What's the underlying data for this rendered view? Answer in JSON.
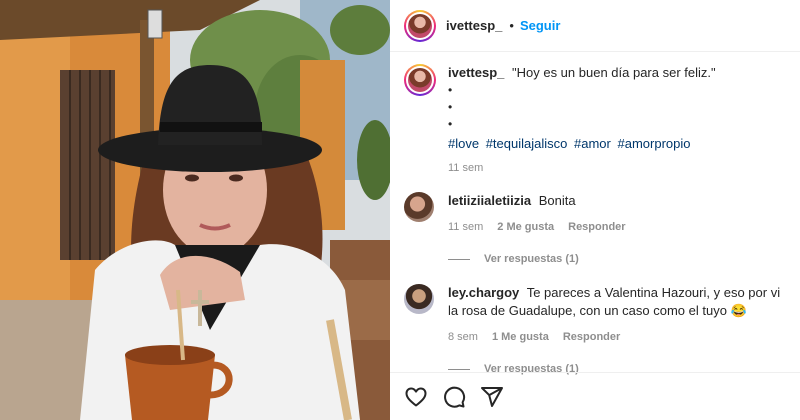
{
  "header": {
    "username": "ivettesp_",
    "separator": "•",
    "follow_label": "Seguir"
  },
  "caption": {
    "username": "ivettesp_",
    "text": "\"Hoy es un buen día para ser feliz.\"",
    "bullets": [
      "•",
      "•",
      "•"
    ],
    "hashtags": [
      "#love",
      "#tequilajalisco",
      "#amor",
      "#amorpropio"
    ],
    "time": "11 sem"
  },
  "comments": [
    {
      "username": "letiiziialetiizia",
      "text": "Bonita",
      "time": "11 sem",
      "likes": "2 Me gusta",
      "reply_label": "Responder",
      "view_replies": "Ver respuestas (1)"
    },
    {
      "username": "ley.chargoy",
      "text": "Te pareces a Valentina Hazouri, y eso por vi la rosa de Guadalupe, con un caso como el tuyo 😂",
      "time": "8 sem",
      "likes": "1 Me gusta",
      "reply_label": "Responder",
      "view_replies": "Ver respuestas (1)"
    }
  ],
  "actions": {
    "icons": [
      "heart-icon",
      "comment-icon",
      "share-icon"
    ]
  },
  "colors": {
    "link_blue": "#0095f6",
    "hashtag": "#00376b",
    "muted": "#8e8e8e"
  }
}
